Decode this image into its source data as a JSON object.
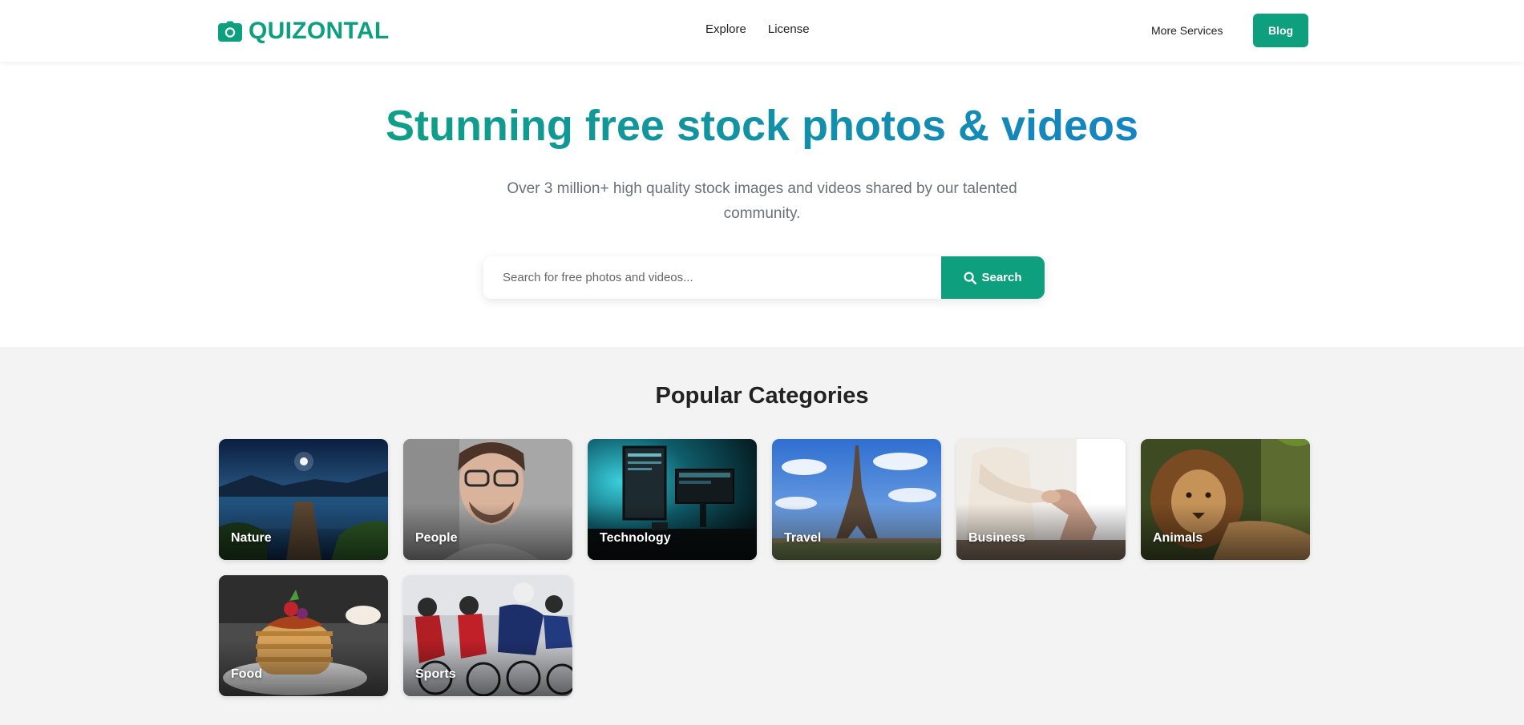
{
  "brand": {
    "name": "QUIZONTAL",
    "icon": "camera-icon",
    "color": "#0e9f7e"
  },
  "nav": {
    "links": [
      "Explore",
      "License"
    ],
    "more_services": "More Services",
    "blog": "Blog"
  },
  "hero": {
    "title": "Stunning free stock photos & videos",
    "subtitle": "Over 3 million+ high quality stock images and videos shared by our talented community.",
    "gradient": [
      "#0f9f87",
      "#1584c4"
    ]
  },
  "search": {
    "placeholder": "Search for free photos and videos...",
    "value": "",
    "button_label": "Search",
    "button_icon": "search-icon"
  },
  "categories": {
    "title": "Popular Categories",
    "items": [
      {
        "label": "Nature"
      },
      {
        "label": "People"
      },
      {
        "label": "Technology"
      },
      {
        "label": "Travel"
      },
      {
        "label": "Business"
      },
      {
        "label": "Animals"
      },
      {
        "label": "Food"
      },
      {
        "label": "Sports"
      }
    ]
  }
}
